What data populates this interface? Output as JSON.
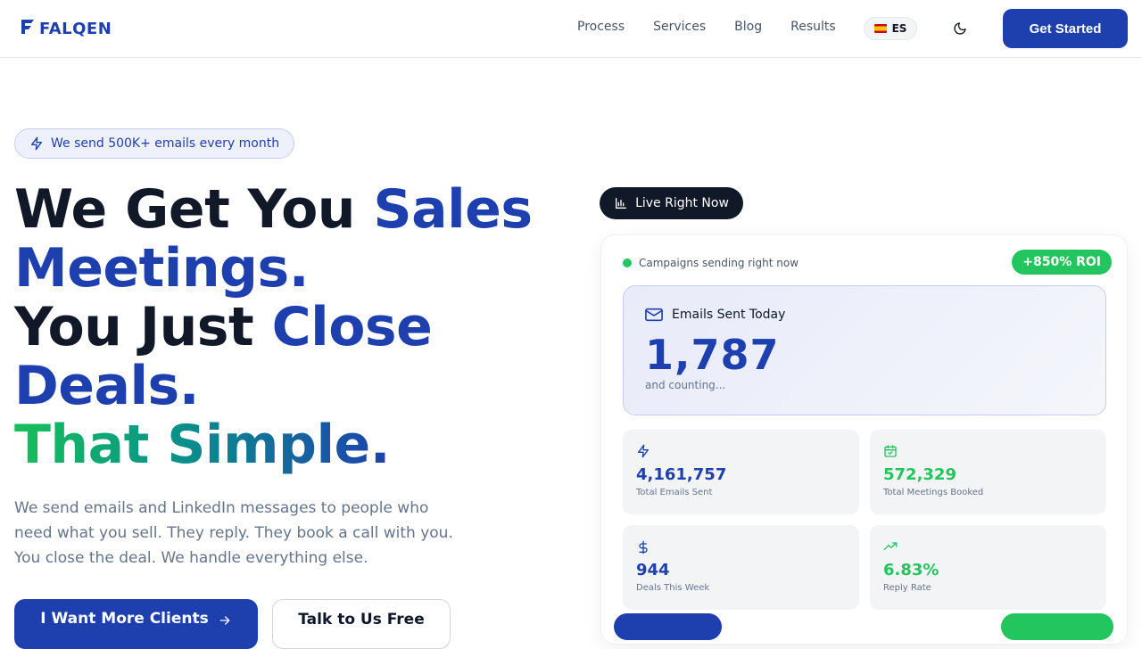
{
  "nav": {
    "brand": "FALQEN",
    "links": [
      "Process",
      "Services",
      "Blog",
      "Results"
    ],
    "lang": "ES",
    "cta": "Get Started"
  },
  "hero": {
    "badge": "We send 500K+ emails every month",
    "headline": {
      "l1a": "We Get You ",
      "l1b": "Sales",
      "l2": "Meetings.",
      "l3a": "You Just ",
      "l3b": "Close",
      "l4": "Deals.",
      "l5": "That Simple."
    },
    "subtitle": "We send emails and LinkedIn messages to people who need what you sell. They reply. They book a call with you. You close the deal. We handle everything else.",
    "primary_cta": "I Want More Clients",
    "secondary_cta": "Talk to Us Free"
  },
  "dashboard": {
    "live_label": "Live Right Now",
    "status": "Campaigns sending right now",
    "roi": "+850% ROI",
    "today": {
      "label": "Emails Sent Today",
      "value": "1,787",
      "sub": "and counting..."
    },
    "stats": [
      {
        "value": "4,161,757",
        "label": "Total Emails Sent",
        "icon": "bolt-icon",
        "color": "#1e3fae"
      },
      {
        "value": "572,329",
        "label": "Total Meetings Booked",
        "icon": "calendar-check-icon",
        "color": "#22c55e"
      },
      {
        "value": "944",
        "label": "Deals This Week",
        "icon": "dollar-icon",
        "color": "#1e3fae"
      },
      {
        "value": "6.83%",
        "label": "Reply Rate",
        "icon": "trending-up-icon",
        "color": "#22c55e"
      }
    ]
  },
  "colors": {
    "primary": "#1e3fae",
    "success": "#22c55e",
    "dark": "#111827"
  }
}
